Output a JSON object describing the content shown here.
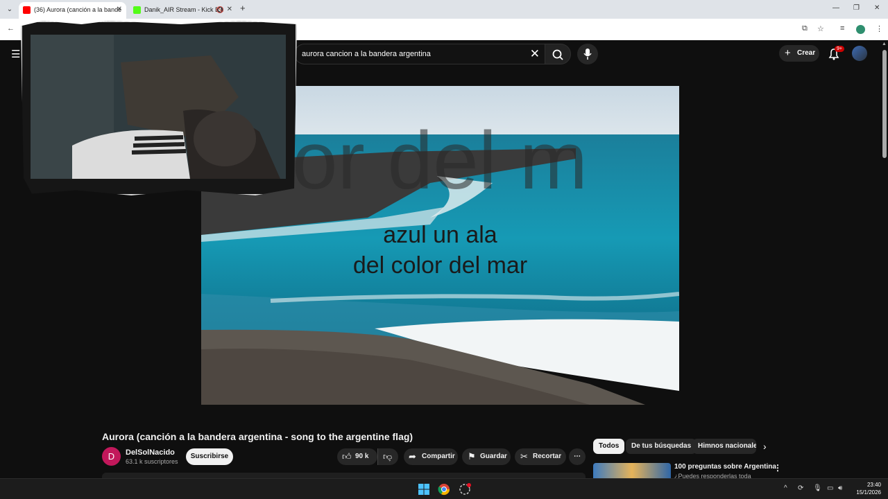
{
  "browser": {
    "tabs": [
      {
        "title": "(36) Aurora (canción a la bande",
        "active": true
      },
      {
        "title": "Danik_AIR Stream - Kick Da",
        "active": false
      }
    ]
  },
  "youtube": {
    "search": {
      "query": "aurora cancion a la bandera argentina"
    },
    "header": {
      "create_label": "Crear",
      "notification_badge": "9+"
    },
    "video": {
      "lyric_line1": "azul un ala",
      "lyric_line2": "del color del mar",
      "ghost_big": "color del m"
    },
    "title": "Aurora (canción a la bandera argentina - song to the argentine flag)",
    "channel": {
      "initial": "D",
      "name": "DelSolNacido",
      "subscribers": "63.1 k suscriptores"
    },
    "subscribe_label": "Suscribirse",
    "actions": {
      "likes": "90 k",
      "share": "Compartir",
      "save": "Guardar",
      "clip": "Recortar"
    },
    "chips": [
      "Todos",
      "De tus búsquedas",
      "Himnos nacionales"
    ],
    "recommendation": {
      "title": "100 preguntas sobre Argentina",
      "subtitle": "¿Puedes responderlas toda"
    }
  },
  "taskbar": {
    "time": "23:40",
    "date": "15/1/2026"
  },
  "colors": {
    "background": "#0f0f0f",
    "accent_red": "#cc0000",
    "channel_avatar": "#c2185b"
  }
}
